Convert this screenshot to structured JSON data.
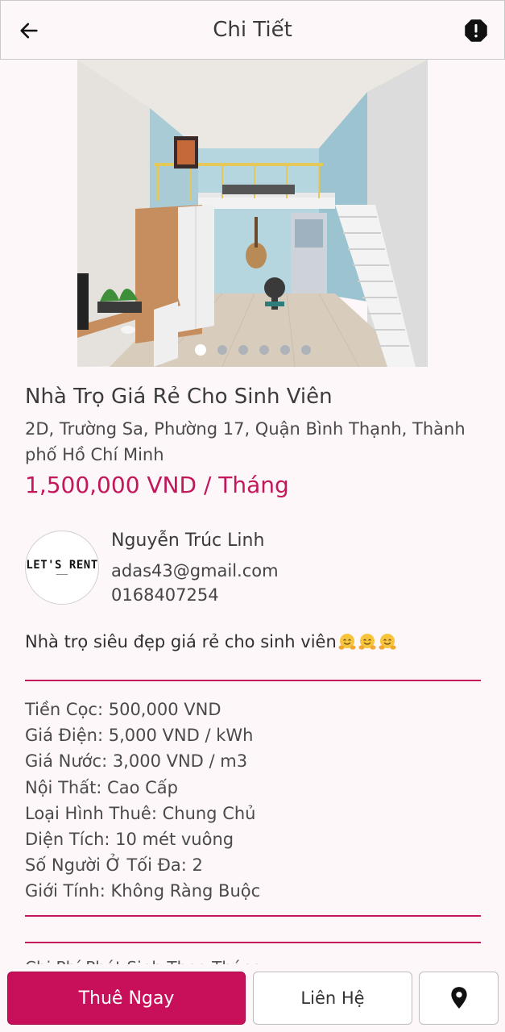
{
  "header": {
    "title": "Chi Tiết",
    "back_icon": "arrow-left-icon",
    "report_icon": "alert-octagon-icon"
  },
  "gallery": {
    "image_count": 6,
    "active_index": 0
  },
  "listing": {
    "title": "Nhà Trọ Giá Rẻ Cho Sinh Viên",
    "address": "2D, Trường Sa, Phường 17, Quận Bình Thạnh, Thành phố Hồ Chí Minh",
    "price": "1,500,000 VND / Tháng"
  },
  "owner": {
    "avatar_text": "LET'S RENT",
    "name": "Nguyễn Trúc Linh",
    "email": "adas43@gmail.com",
    "phone": "0168407254"
  },
  "description": "Nhà trọ siêu đẹp giá rẻ cho sinh viên",
  "specs": [
    "Tiền Cọc: 500,000 VND",
    "Giá Điện: 5,000 VND / kWh",
    "Giá Nước: 3,000 VND / m3",
    "Nội Thất: Cao Cấp",
    "Loại Hình Thuê: Chung Chủ",
    "Diện Tích: 10 mét vuông",
    "Số Người Ở Tối Đa: 2",
    "Giới Tính: Không Ràng Buộc"
  ],
  "next_section_label": "Chi Phí Phát Sinh Theo Tháng",
  "actions": {
    "rent_label": "Thuê Ngay",
    "contact_label": "Liên Hệ",
    "map_icon": "map-pin-icon"
  },
  "colors": {
    "accent": "#c8105a",
    "background": "#fdf7f9"
  }
}
